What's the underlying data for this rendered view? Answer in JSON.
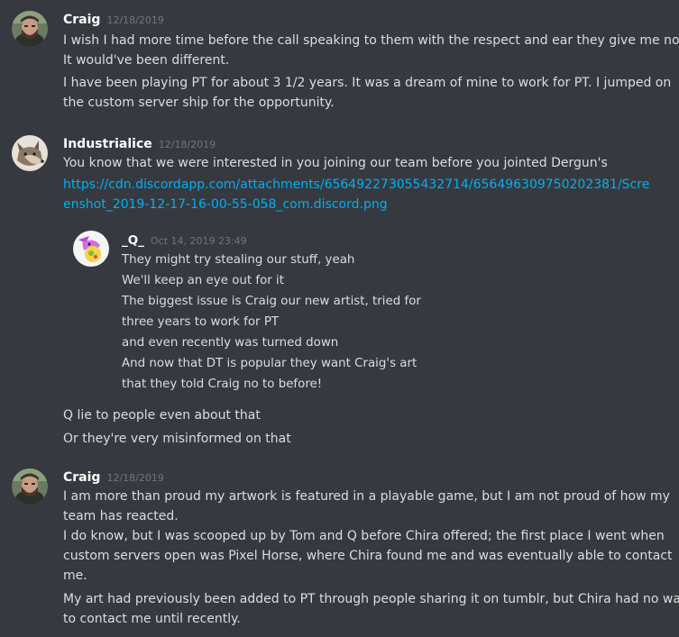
{
  "messages": [
    {
      "author": "Craig",
      "timestamp": "12/18/2019",
      "avatar_icon": "bearded-man-avatar-icon",
      "lines": [
        "I wish I had more time before the call speaking to them with the respect and ear they give me now.",
        "It would've been different.",
        "I have been playing PT for about 3 1/2 years. It was a dream of mine to work for PT. I jumped on",
        "the custom server ship for the opportunity."
      ]
    },
    {
      "author": "Industrialice",
      "timestamp": "12/18/2019",
      "avatar_icon": "wolf-avatar-icon",
      "lines": [
        "You know that we were interested in you joining our team before you jointed Dergun's"
      ],
      "link_lines": [
        "https://cdn.discordapp.com/attachments/656492273055432714/656496309750202381/Scre",
        "enshot_2019-12-17-16-00-55-058_com.discord.png"
      ],
      "quoted": {
        "author": "_Q_",
        "timestamp": "Oct 14, 2019 23:49",
        "avatar_icon": "dragon-avatar-icon",
        "lines": [
          "They might try stealing our stuff, yeah",
          "We'll keep an eye out for it",
          "The biggest issue is Craig our new artist, tried for",
          "three years to work for PT",
          "and even recently was turned down",
          "And now that DT is popular they want Craig's art",
          "that they told Craig no to before!"
        ]
      },
      "after_lines": [
        "Q lie to people even about that",
        "Or they're very misinformed on that"
      ]
    },
    {
      "author": "Craig",
      "timestamp": "12/18/2019",
      "avatar_icon": "bearded-man-avatar-icon",
      "lines": [
        "I am more than proud my artwork is featured in a playable game, but I am not proud of how my",
        "team has reacted.",
        "I do know, but I was scooped up by Tom and Q before Chira offered; the first place I went when",
        "custom servers open was Pixel Horse, where Chira found me and was eventually able to contact",
        "me.",
        "My art had previously been added to PT through people sharing it on tumblr, but Chira had no way",
        "to contact me until recently."
      ]
    }
  ],
  "colors": {
    "background": "#36393f",
    "text": "#dcddde",
    "username": "#ffffff",
    "timestamp": "#72767d",
    "link": "#00b0f4"
  }
}
